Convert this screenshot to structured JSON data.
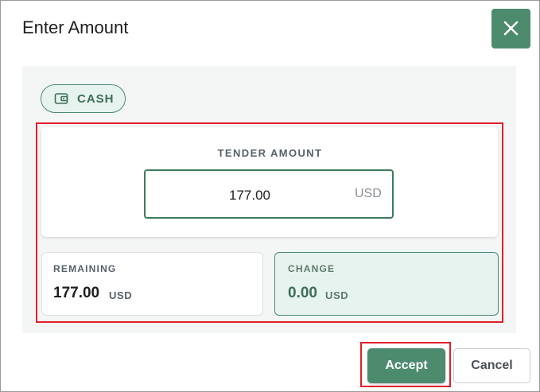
{
  "dialog": {
    "title": "Enter Amount",
    "close_icon": "close-icon"
  },
  "payment_method": {
    "label": "CASH",
    "icon": "wallet-icon"
  },
  "tender": {
    "label": "TENDER AMOUNT",
    "value": "177.00",
    "currency": "USD"
  },
  "remaining": {
    "label": "REMAINING",
    "value": "177.00",
    "unit": "USD"
  },
  "change": {
    "label": "CHANGE",
    "value": "0.00",
    "unit": "USD"
  },
  "actions": {
    "accept_label": "Accept",
    "cancel_label": "Cancel"
  },
  "colors": {
    "primary": "#4d8b6f",
    "highlight": "#e0202a",
    "change_bg": "#e7f3ee"
  }
}
